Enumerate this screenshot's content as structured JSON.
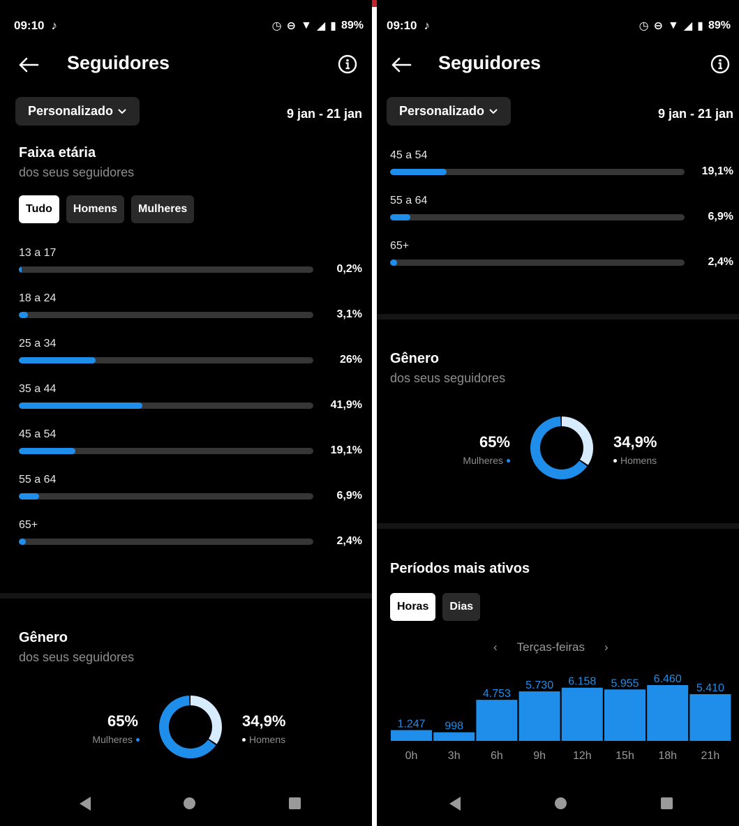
{
  "status": {
    "time": "09:10",
    "battery": "89%"
  },
  "header": {
    "title": "Seguidores",
    "back_icon": "back-arrow-icon",
    "info_icon": "info-icon"
  },
  "filter": {
    "period": "Personalizado",
    "date_range": "9 jan - 21 jan"
  },
  "age": {
    "title": "Faixa etária",
    "subtitle": "dos seus seguidores",
    "tabs": [
      "Tudo",
      "Homens",
      "Mulheres"
    ],
    "active_tab": "Tudo",
    "rows": [
      {
        "label": "13 a 17",
        "pct_text": "0,2%",
        "value": 0.2
      },
      {
        "label": "18 a 24",
        "pct_text": "3,1%",
        "value": 3.1
      },
      {
        "label": "25 a 34",
        "pct_text": "26%",
        "value": 26
      },
      {
        "label": "35 a 44",
        "pct_text": "41,9%",
        "value": 41.9
      },
      {
        "label": "45 a 54",
        "pct_text": "19,1%",
        "value": 19.1
      },
      {
        "label": "55 a 64",
        "pct_text": "6,9%",
        "value": 6.9
      },
      {
        "label": "65+",
        "pct_text": "2,4%",
        "value": 2.4
      }
    ]
  },
  "gender": {
    "title": "Gênero",
    "subtitle": "dos seus seguidores",
    "women_pct": "65%",
    "women_label": "Mulheres",
    "men_pct": "34,9%",
    "men_label": "Homens",
    "women_value": 65,
    "men_value": 34.9
  },
  "active": {
    "title": "Períodos mais ativos",
    "tabs": [
      "Horas",
      "Dias"
    ],
    "active_tab": "Horas",
    "day_label": "Terças-feiras"
  },
  "colors": {
    "accent": "#1f8eea",
    "men": "#d8ecff",
    "track": "#363636",
    "background": "#000000"
  },
  "chart_data": [
    {
      "type": "bar",
      "orientation": "horizontal",
      "categories": [
        "13 a 17",
        "18 a 24",
        "25 a 34",
        "35 a 44",
        "45 a 54",
        "55 a 64",
        "65+"
      ],
      "values": [
        0.2,
        3.1,
        26,
        41.9,
        19.1,
        6.9,
        2.4
      ],
      "title": "Faixa etária"
    },
    {
      "type": "pie",
      "categories": [
        "Mulheres",
        "Homens"
      ],
      "values": [
        65,
        34.9
      ],
      "title": "Gênero"
    },
    {
      "type": "bar",
      "categories": [
        "0h",
        "3h",
        "6h",
        "9h",
        "12h",
        "15h",
        "18h",
        "21h"
      ],
      "values": [
        1247,
        998,
        4753,
        5730,
        6158,
        5955,
        6460,
        5410
      ],
      "value_labels": [
        "1.247",
        "998",
        "4.753",
        "5.730",
        "6.158",
        "5.955",
        "6.460",
        "5.410"
      ],
      "title": "Períodos mais ativos"
    }
  ]
}
